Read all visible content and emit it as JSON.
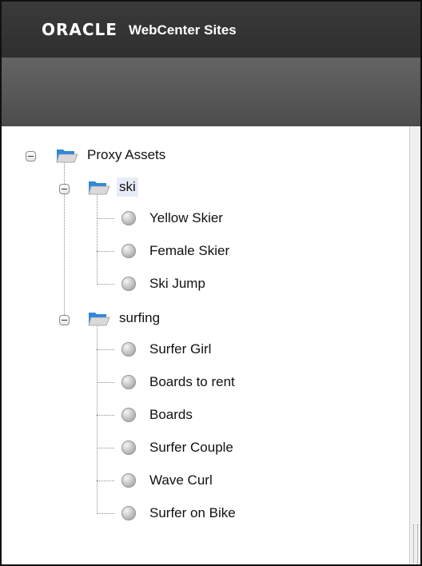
{
  "header": {
    "brand": "ORACLE",
    "product": "WebCenter Sites"
  },
  "tree": {
    "root": {
      "label": "Proxy Assets",
      "icon": "open-folder-icon",
      "expanded": true
    },
    "folders": [
      {
        "label": "ski",
        "icon": "open-folder-icon",
        "expanded": true,
        "selected": true,
        "items": [
          "Yellow Skier",
          "Female Skier",
          "Ski Jump"
        ]
      },
      {
        "label": "surfing",
        "icon": "open-folder-icon",
        "expanded": true,
        "selected": false,
        "items": [
          "Surfer Girl",
          "Boards to rent",
          "Boards",
          "Surfer Couple",
          "Wave Curl",
          "Surfer on Bike"
        ]
      }
    ],
    "item_icon": "gray-ball-icon"
  },
  "colors": {
    "header_bg": "#333333",
    "toolbar_bg": "#5a5a5a",
    "selection_bg": "#e7ecf8",
    "folder_blue": "#2f88d8"
  }
}
